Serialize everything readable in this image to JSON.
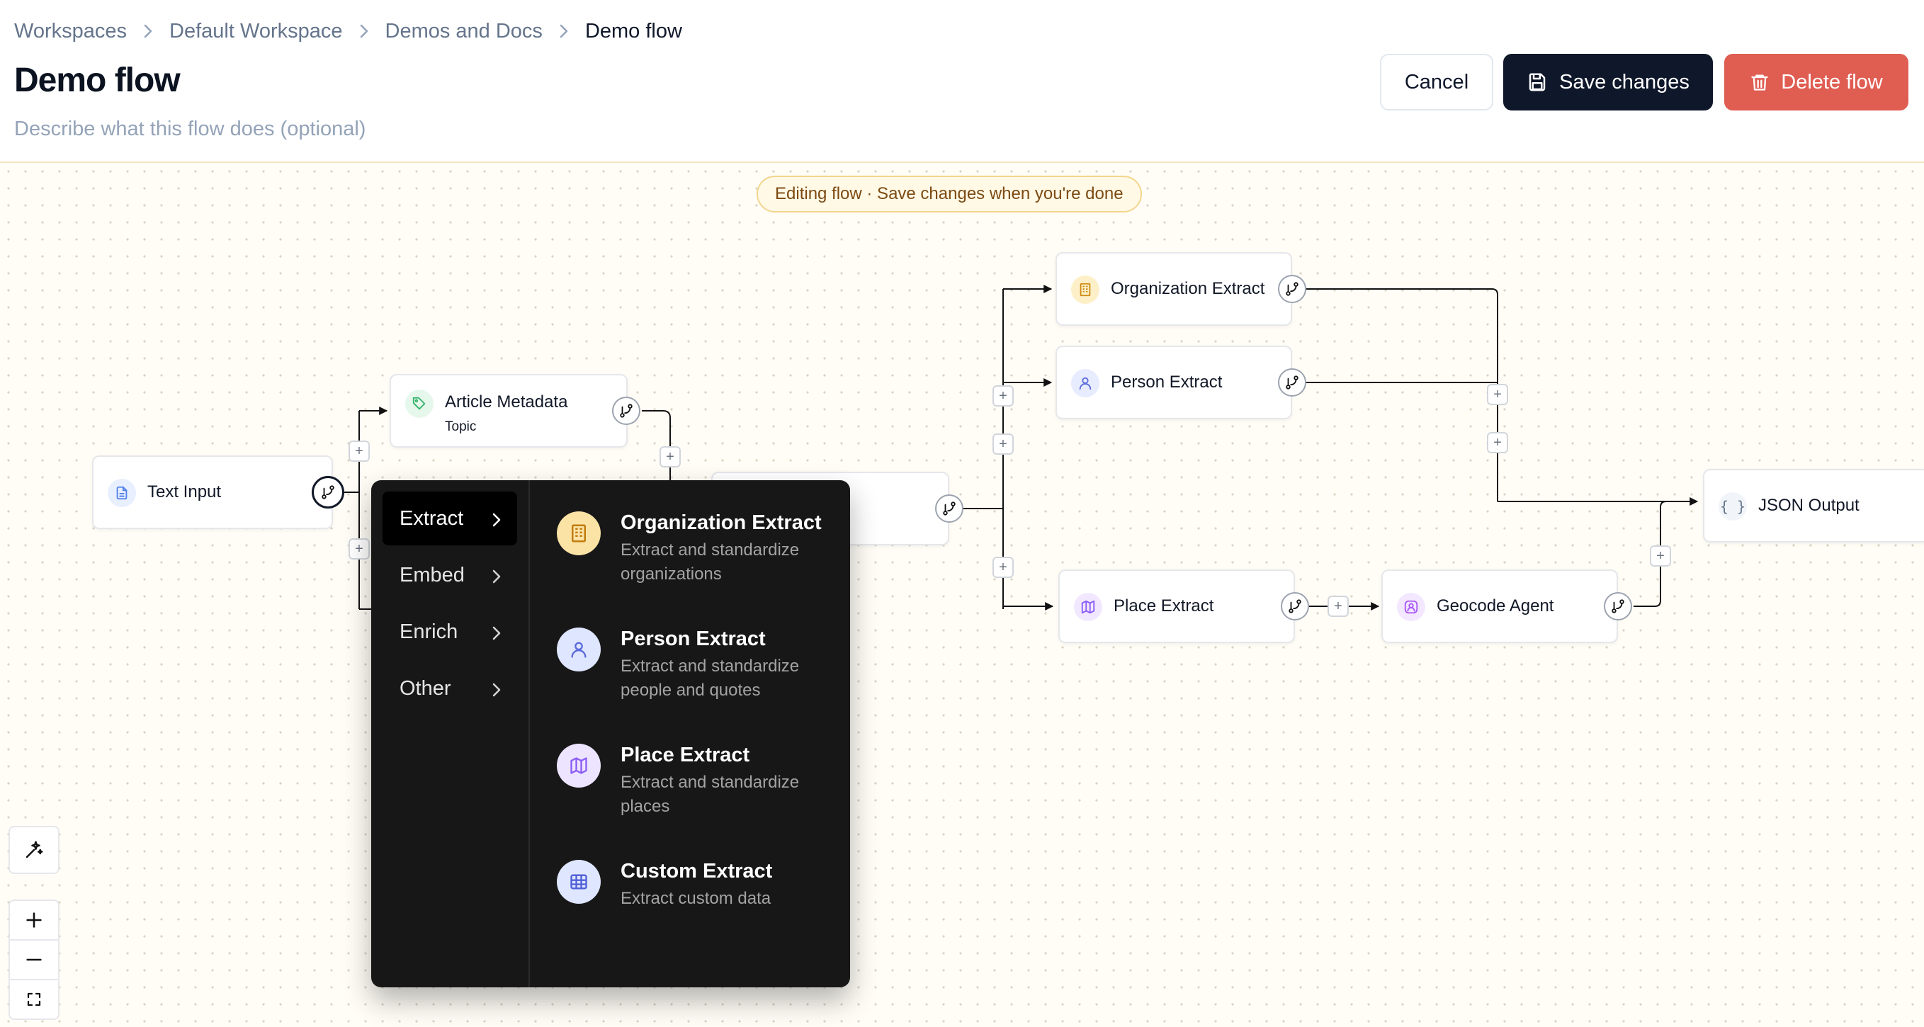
{
  "breadcrumb": [
    "Workspaces",
    "Default Workspace",
    "Demos and Docs",
    "Demo flow"
  ],
  "page": {
    "title": "Demo flow",
    "description_placeholder": "Describe what this flow does (optional)"
  },
  "actions": {
    "cancel": "Cancel",
    "save": "Save changes",
    "delete": "Delete flow"
  },
  "banner": "Editing flow · Save changes when you're done",
  "nodes": {
    "text_input": {
      "label": "Text Input",
      "icon": "file-text-icon"
    },
    "article_metadata": {
      "label": "Article Metadata",
      "sublabel": "Topic",
      "icon": "tag-icon"
    },
    "organization_extract": {
      "label": "Organization Extract",
      "icon": "building-icon"
    },
    "person_extract": {
      "label": "Person Extract",
      "icon": "user-icon"
    },
    "place_extract": {
      "label": "Place Extract",
      "icon": "map-icon"
    },
    "geocode_agent": {
      "label": "Geocode Agent",
      "icon": "user-pin-icon"
    },
    "json_output": {
      "label": "JSON Output",
      "icon": "braces-icon"
    }
  },
  "menu": {
    "categories": [
      "Extract",
      "Embed",
      "Enrich",
      "Other"
    ],
    "selected": "Extract",
    "options": [
      {
        "title": "Organization Extract",
        "description": "Extract and standardize organizations",
        "icon": "building-icon"
      },
      {
        "title": "Person Extract",
        "description": "Extract and standardize people and quotes",
        "icon": "user-icon"
      },
      {
        "title": "Place Extract",
        "description": "Extract and standardize places",
        "icon": "map-icon"
      },
      {
        "title": "Custom Extract",
        "description": "Extract custom data",
        "icon": "table-icon"
      }
    ]
  },
  "colors": {
    "primary": "#0f172a",
    "danger": "#e05d52",
    "banner_bg": "#fff9e6",
    "banner_border": "#f3d58e",
    "menu_bg": "#171717"
  }
}
